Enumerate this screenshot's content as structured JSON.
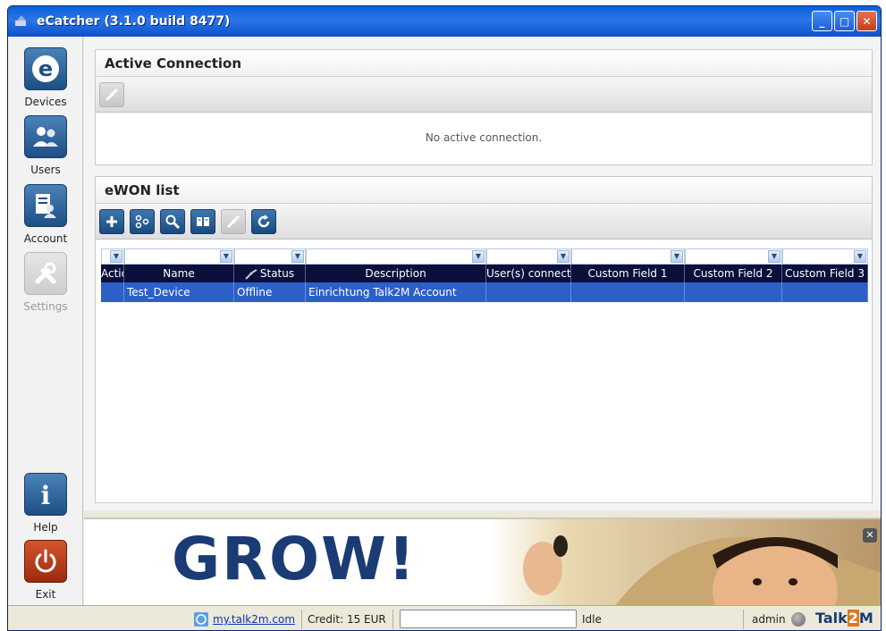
{
  "window": {
    "title": "eCatcher  (3.1.0 build 8477)",
    "minimize": "_",
    "maximize": "□",
    "close": "✕"
  },
  "sidebar": {
    "items": [
      {
        "label": "Devices",
        "icon": "devices-icon",
        "enabled": true
      },
      {
        "label": "Users",
        "icon": "users-icon",
        "enabled": true
      },
      {
        "label": "Account",
        "icon": "account-icon",
        "enabled": true
      },
      {
        "label": "Settings",
        "icon": "settings-icon",
        "enabled": false
      },
      {
        "label": "Help",
        "icon": "help-icon",
        "enabled": true
      },
      {
        "label": "Exit",
        "icon": "power-icon",
        "enabled": true
      }
    ]
  },
  "active_connection": {
    "title": "Active Connection",
    "message": "No active connection."
  },
  "ewon_list": {
    "title": "eWON list",
    "toolbar": [
      "add-icon",
      "group-icon",
      "search-icon",
      "book-icon",
      "connect-icon",
      "refresh-icon"
    ],
    "columns": [
      "Actio",
      "Name",
      "Status",
      "Description",
      "User(s) connecte",
      "Custom Field 1",
      "Custom Field 2",
      "Custom Field 3"
    ],
    "rows": [
      {
        "action": "",
        "name": "Test_Device",
        "status": "Offline",
        "description": "Einrichtung Talk2M Account",
        "users": "",
        "cf1": "",
        "cf2": "",
        "cf3": ""
      }
    ]
  },
  "banner": {
    "headline": "GROW!",
    "close": "✕"
  },
  "statusbar": {
    "link": "my.talk2m.com",
    "credit": "Credit: 15 EUR",
    "field_value": "",
    "status": "Idle",
    "user": "admin",
    "brand_left": "Talk",
    "brand_mid": "2",
    "brand_right": "M"
  },
  "colors": {
    "header_bg": "#0b0f3c",
    "selected_row": "#2d5fc8",
    "brand_blue": "#1a3b73",
    "brand_orange": "#e07818"
  }
}
